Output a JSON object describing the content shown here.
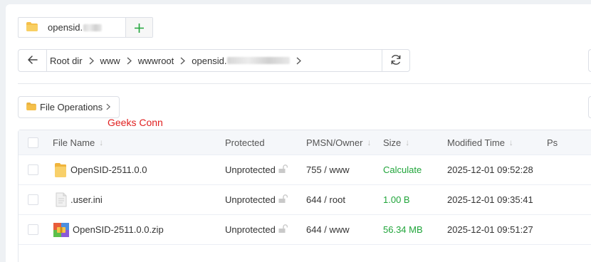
{
  "tab": {
    "label": "opensid."
  },
  "address": {
    "crumbs": [
      "Root dir",
      "www",
      "wwwroot",
      "opensid."
    ]
  },
  "toolbar": {
    "file_ops_label": "File Operations"
  },
  "watermark": "Geeks Conn",
  "table": {
    "headers": {
      "name": "File Name",
      "protected": "Protected",
      "pmsn": "PMSN/Owner",
      "size": "Size",
      "modified": "Modified Time",
      "ps": "Ps"
    },
    "rows": [
      {
        "name": "OpenSID-2511.0.0",
        "icon": "folder-icon",
        "protected": "Unprotected",
        "pmsn": "755 / www",
        "size": "Calculate",
        "modified": "2025-12-01 09:52:28"
      },
      {
        "name": ".user.ini",
        "icon": "file-icon",
        "protected": "Unprotected",
        "pmsn": "644 / root",
        "size": "1.00 B",
        "modified": "2025-12-01 09:35:41"
      },
      {
        "name": "OpenSID-2511.0.0.zip",
        "icon": "zip-archive-icon",
        "protected": "Unprotected",
        "pmsn": "644 / www",
        "size": "56.34 MB",
        "modified": "2025-12-01 09:51:27"
      }
    ]
  },
  "colors": {
    "accent": "#20a53a",
    "watermark": "#e02020",
    "folder": "#f5c04a"
  }
}
